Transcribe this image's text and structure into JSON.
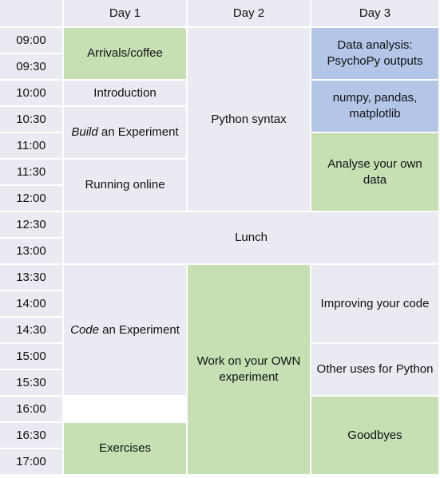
{
  "colors": {
    "neutral": "#eaeaf2",
    "green": "#c6e0b4",
    "blue": "#b4c6e7",
    "border": "#ffffff"
  },
  "header": {
    "corner": "",
    "days": [
      "Day 1",
      "Day 2",
      "Day 3"
    ]
  },
  "times": [
    "09:00",
    "09:30",
    "10:00",
    "10:30",
    "11:00",
    "11:30",
    "12:00",
    "12:30",
    "13:00",
    "13:30",
    "14:00",
    "14:30",
    "15:00",
    "15:30",
    "16:00",
    "16:30",
    "17:00"
  ],
  "sessions": {
    "day1": [
      {
        "text": "Arrivals/coffee",
        "color": "green"
      },
      {
        "text": "Introduction",
        "color": "neutral"
      },
      {
        "italic": "Build",
        "text": " an Experiment",
        "color": "neutral"
      },
      {
        "text": "Running online",
        "color": "neutral"
      },
      {
        "italic": "Code",
        "text": " an Experiment",
        "color": "neutral"
      },
      {
        "text": "Exercises",
        "color": "green"
      }
    ],
    "day2": [
      {
        "text": "Python syntax",
        "color": "neutral"
      },
      {
        "text": "Work on your OWN experiment",
        "color": "green"
      }
    ],
    "day3": [
      {
        "text": "Data analysis: PsychoPy outputs",
        "color": "blue"
      },
      {
        "text": "numpy, pandas, matplotlib",
        "color": "blue"
      },
      {
        "text": "Analyse your own data",
        "color": "green"
      },
      {
        "text": "Improving your code",
        "color": "neutral"
      },
      {
        "text": "Other uses for Python",
        "color": "neutral"
      },
      {
        "text": "Goodbyes",
        "color": "green"
      }
    ],
    "lunch": {
      "text": "Lunch",
      "color": "neutral"
    }
  }
}
